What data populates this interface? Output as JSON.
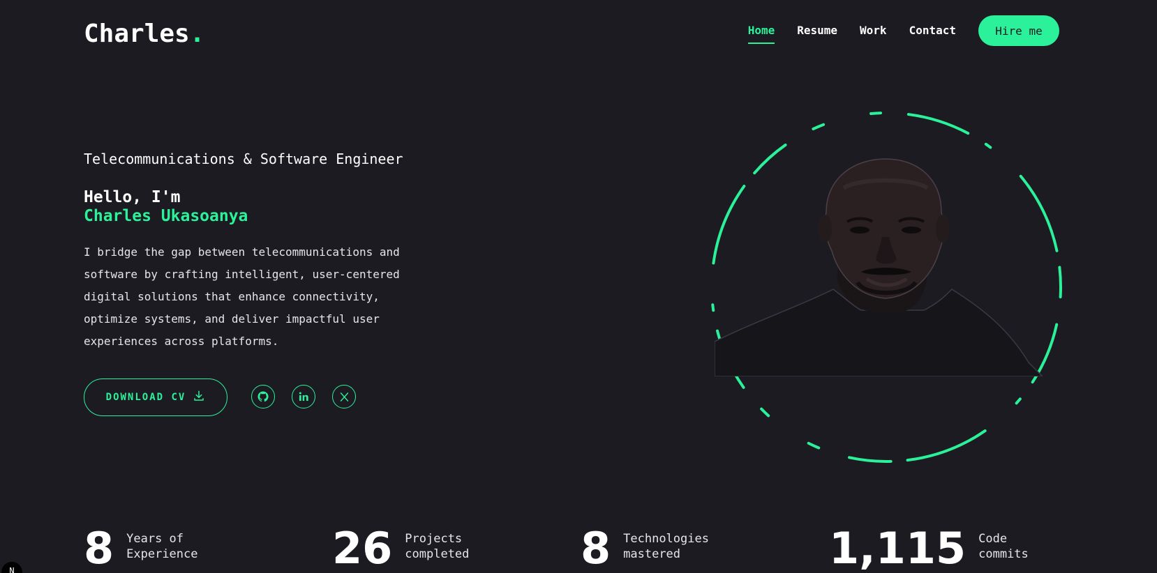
{
  "header": {
    "logo_text": "Charles",
    "logo_dot": ".",
    "nav": [
      {
        "label": "Home",
        "active": true
      },
      {
        "label": "Resume",
        "active": false
      },
      {
        "label": "Work",
        "active": false
      },
      {
        "label": "Contact",
        "active": false
      }
    ],
    "hire_label": "Hire me"
  },
  "hero": {
    "tagline": "Telecommunications & Software Engineer",
    "greeting": "Hello, I'm",
    "name": "Charles Ukasoanya",
    "intro": "I bridge the gap between telecommunications and software by crafting intelligent, user-centered digital solutions that enhance connectivity, optimize systems, and deliver impactful user experiences across platforms.",
    "download_label": "DOWNLOAD CV",
    "socials": [
      {
        "icon": "github-icon"
      },
      {
        "icon": "linkedin-icon"
      },
      {
        "icon": "x-icon"
      }
    ]
  },
  "stats": [
    {
      "value": "8",
      "label": "Years of Experience"
    },
    {
      "value": "26",
      "label": "Projects completed"
    },
    {
      "value": "8",
      "label": "Technologies mastered"
    },
    {
      "value": "1,115",
      "label": "Code commits"
    }
  ],
  "dev_badge": "N",
  "colors": {
    "accent": "#2bf29a",
    "background": "#1c1b22",
    "text": "#ffffff"
  }
}
